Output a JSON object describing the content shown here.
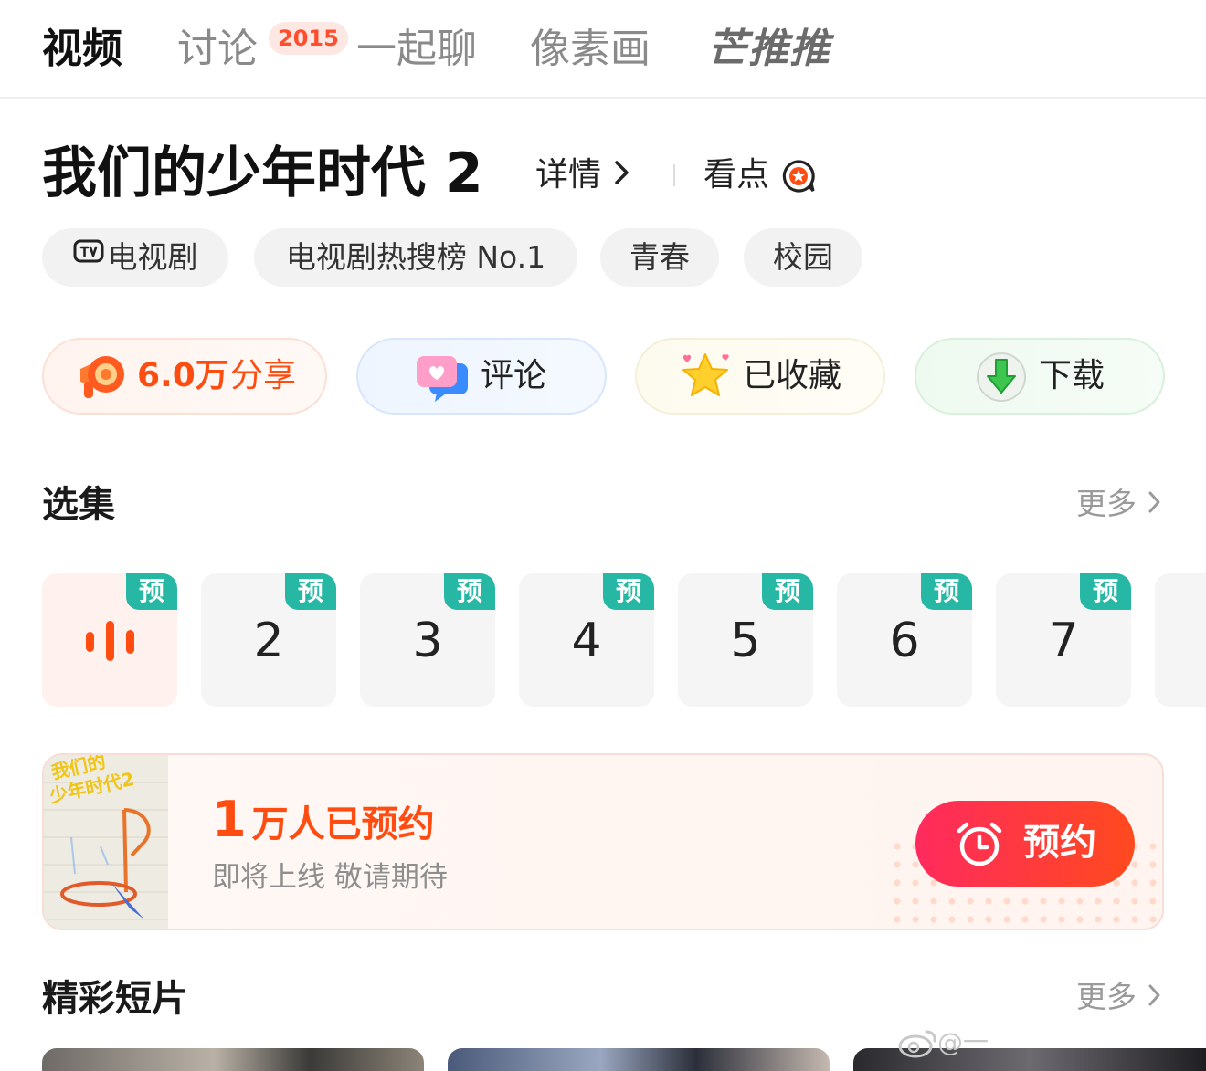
{
  "tabs": [
    {
      "label": "视频",
      "active": true
    },
    {
      "label": "讨论",
      "badge": "2015"
    },
    {
      "label": "一起聊"
    },
    {
      "label": "像素画"
    },
    {
      "label": "芒推推"
    }
  ],
  "show": {
    "title": "我们的少年时代 2",
    "detail_label": "详情",
    "highlight_label": "看点",
    "tags": [
      "电视剧",
      "电视剧热搜榜 No.1",
      "青春",
      "校园"
    ]
  },
  "actions": {
    "share_count": "6.0万",
    "share_label": "分享",
    "comment_label": "评论",
    "favorite_label": "已收藏",
    "download_label": "下载"
  },
  "episodes": {
    "title": "选集",
    "more_label": "更多",
    "badge": "预",
    "numbers": [
      "2",
      "3",
      "4",
      "5",
      "6",
      "7"
    ]
  },
  "reserve": {
    "count": "1",
    "count_text": "万人已预约",
    "subtitle": "即将上线 敬请期待",
    "button_label": "预约",
    "poster_text": "我们的少年时代2"
  },
  "clips": {
    "title": "精彩短片",
    "more_label": "更多"
  },
  "watermark": "@一",
  "colors": {
    "accent_orange": "#ff4d12",
    "badge_teal": "#26b8a5",
    "reserve_gradient_start": "#ff2a5e",
    "reserve_gradient_end": "#ff4a1e"
  }
}
